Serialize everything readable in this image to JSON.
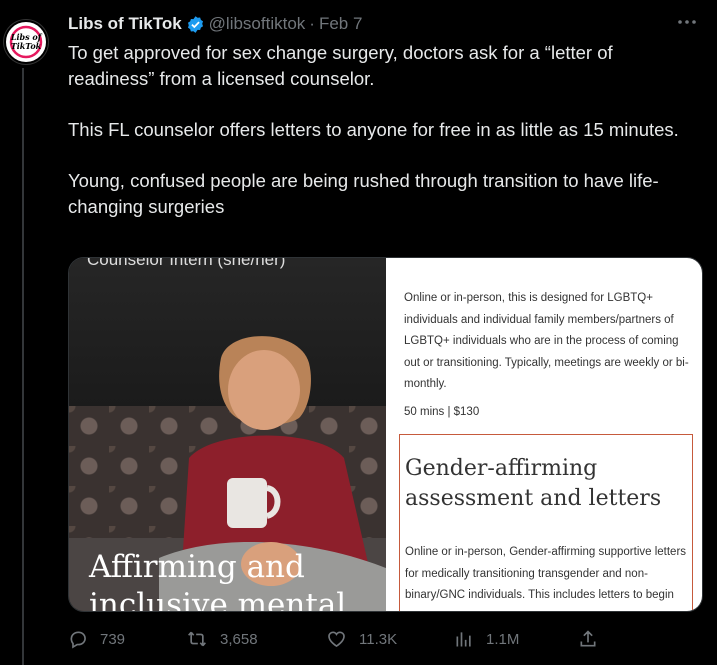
{
  "author": {
    "display_name": "Libs of TikTok",
    "handle": "@libsoftiktok",
    "separator": "·",
    "date": "Feb 7",
    "avatar_text_line1": "Libs of",
    "avatar_text_line2": "TikTok"
  },
  "tweet": {
    "paragraphs": [
      "To get approved for sex change surgery, doctors ask for a “letter of readiness” from a licensed counselor.",
      "This FL counselor offers letters to anyone for free in as little as 15 minutes.",
      "Young, confused people are being rushed through transition to have life-changing surgeries"
    ]
  },
  "media": {
    "left": {
      "top_caption": "Counselor Intern (she/her)",
      "big_caption": "Affirming and inclusive mental"
    },
    "right": {
      "description": "Online or in-person, this is designed for LGBTQ+ individuals and individual family members/partners of LGBTQ+ individuals who are in the process of coming out or transitioning. Typically, meetings are weekly or bi-monthly.",
      "price_line": "50 mins |  $130",
      "service_title": "Gender-affirming assessment and letters",
      "service_description": "Online or in-person, Gender-affirming supportive letters for medically transitioning transgender and non-binary/GNC individuals. This includes letters to begin"
    }
  },
  "actions": {
    "replies": "739",
    "reposts": "3,658",
    "likes": "11.3K",
    "views": "1.1M"
  },
  "colors": {
    "background": "#000000",
    "text": "#e7e9ea",
    "muted": "#71767b",
    "verified": "#1d9bf0",
    "annotation": "#c65a3c"
  }
}
